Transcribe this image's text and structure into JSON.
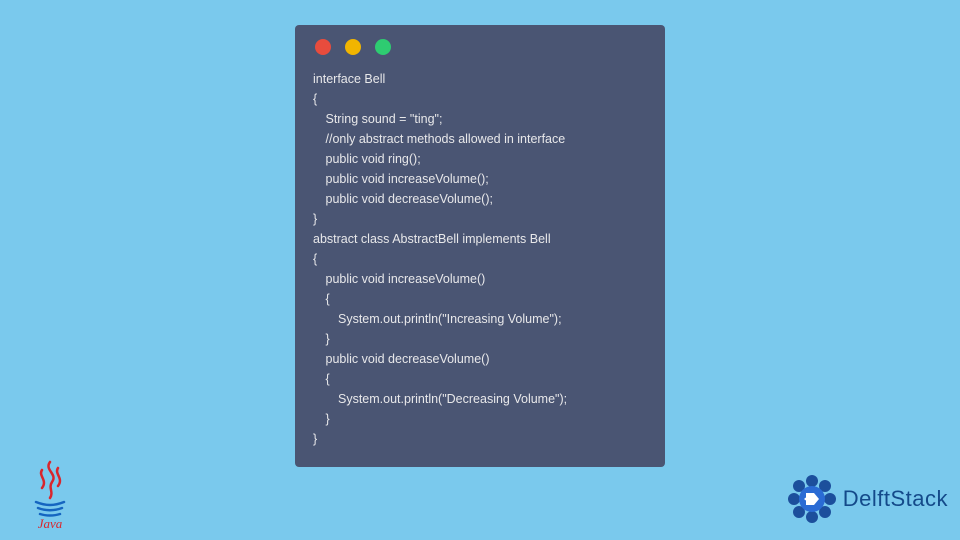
{
  "window": {
    "colors": {
      "bg": "#4a5573",
      "red": "#e84c3d",
      "yellow": "#f1b500",
      "green": "#2ecc71"
    }
  },
  "code_lines": [
    "interface Bell",
    "{",
    " String sound = \"ting\";",
    " //only abstract methods allowed in interface",
    " public void ring(); ",
    " public void increaseVolume();",
    " public void decreaseVolume();",
    "}",
    "abstract class AbstractBell implements Bell",
    "{",
    " public void increaseVolume()",
    " {",
    "  System.out.println(\"Increasing Volume\");",
    " }",
    " public void decreaseVolume()",
    " {",
    "  System.out.println(\"Decreasing Volume\");",
    " }",
    "}"
  ],
  "logos": {
    "java_label": "Java",
    "delft_label": "DelftStack"
  }
}
